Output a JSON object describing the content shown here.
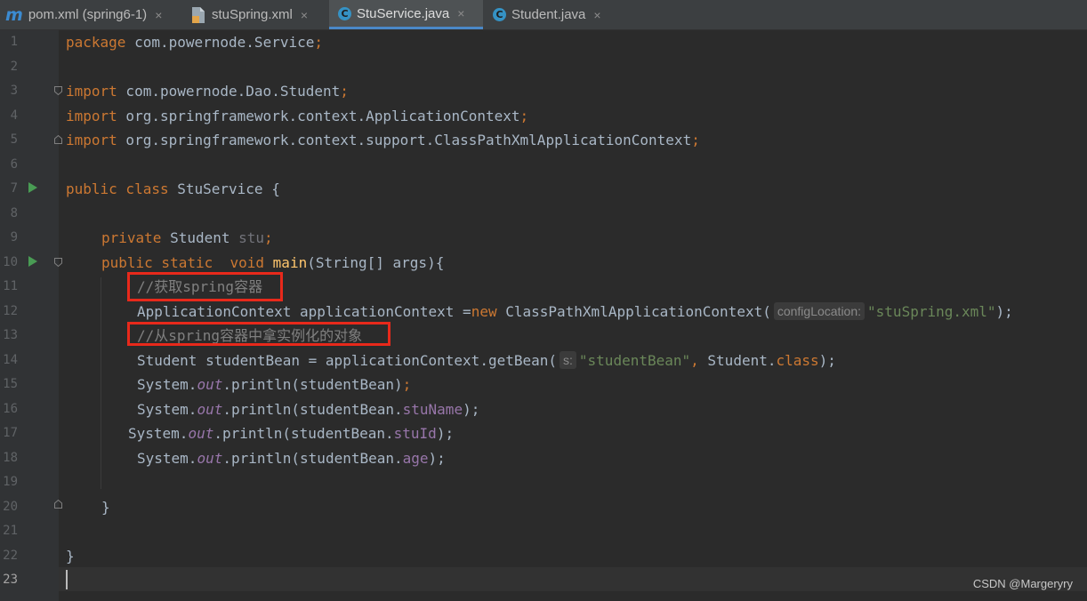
{
  "tabs": [
    {
      "icon": "maven-m-icon",
      "icon_glyph": "m",
      "label": "pom.xml (spring6-1)",
      "close": "×",
      "active": false
    },
    {
      "icon": "xml-file-icon",
      "label": "stuSpring.xml",
      "close": "×",
      "active": false
    },
    {
      "icon": "java-class-icon",
      "icon_glyph": "C",
      "label": "StuService.java",
      "close": "×",
      "active": true
    },
    {
      "icon": "java-class-icon",
      "icon_glyph": "C",
      "label": "Student.java",
      "close": "×",
      "active": false
    }
  ],
  "line_numbers": [
    "1",
    "2",
    "3",
    "4",
    "5",
    "6",
    "7",
    "8",
    "9",
    "10",
    "11",
    "12",
    "13",
    "14",
    "15",
    "16",
    "17",
    "18",
    "19",
    "20",
    "21",
    "22",
    "23"
  ],
  "code": {
    "l1": {
      "kw": "package",
      "rest": " com.powernode.Service",
      "semi": ";"
    },
    "l3": {
      "kw": "import",
      "rest": " com.powernode.Dao.Student",
      "semi": ";"
    },
    "l4": {
      "kw": "import",
      "rest": " org.springframework.context.ApplicationContext",
      "semi": ";"
    },
    "l5": {
      "kw": "import",
      "rest": " org.springframework.context.support.ClassPathXmlApplicationContext",
      "semi": ";"
    },
    "l7": {
      "kw": "public class",
      "rest": " StuService {"
    },
    "l9": {
      "kw": "private",
      "type": " Student ",
      "var": "stu",
      "semi": ";"
    },
    "l10": {
      "kw": "public static  void",
      "fn": "main",
      "rest": "(String[] args){"
    },
    "l11": {
      "comment": "//获取spring容器"
    },
    "l12": {
      "a": "ApplicationContext applicationContext =",
      "kw": "new",
      "b": " ClassPathXmlApplicationContext(",
      "hint": "configLocation:",
      "str": "\"stuSpring.xml\"",
      "end": ");"
    },
    "l13": {
      "comment": "//从spring容器中拿实例化的对象"
    },
    "l14": {
      "a": "Student studentBean = applicationContext.getBean(",
      "hint": "s:",
      "str": "\"studentBean\"",
      "comma": ",",
      "b": " Student.",
      "kw": "class",
      "end": ");"
    },
    "l15": {
      "a": "System.",
      "out": "out",
      "b": ".println(studentBean)",
      "semi": ";"
    },
    "l16": {
      "a": "System.",
      "out": "out",
      "b": ".println(studentBean.",
      "field": "stuName",
      "end": ");"
    },
    "l17": {
      "a": "System.",
      "out": "out",
      "b": ".println(studentBean.",
      "field": "stuId",
      "end": ");"
    },
    "l18": {
      "a": "System.",
      "out": "out",
      "b": ".println(studentBean.",
      "field": "age",
      "end": ");"
    },
    "l20": {
      "rest": "}"
    },
    "l22": {
      "rest": "}"
    }
  },
  "watermark": "CSDN @Margeryry",
  "colors": {
    "keyword": "#cc7832",
    "string": "#6a8759",
    "comment": "#808080",
    "field": "#9876aa",
    "method": "#ffc66d",
    "highlight": "#e8291b",
    "accent": "#4a88c7"
  }
}
